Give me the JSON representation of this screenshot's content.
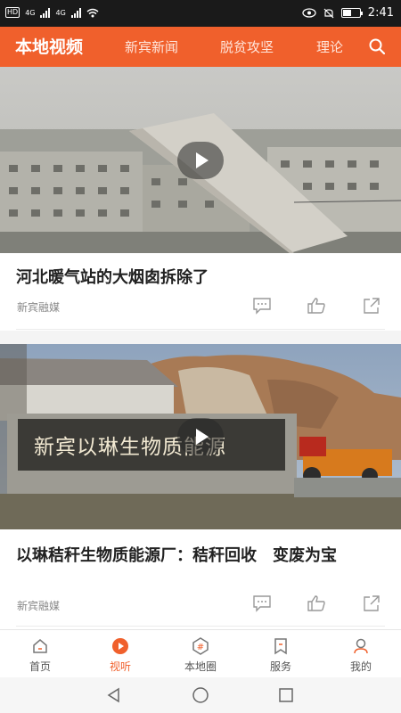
{
  "status_bar": {
    "hd_badge": "HD",
    "net1": "4G",
    "net2": "4G",
    "time": "2:41"
  },
  "header": {
    "tabs": [
      {
        "label": "本地视频",
        "active": true
      },
      {
        "label": "新宾新闻",
        "active": false
      },
      {
        "label": "脱贫攻坚",
        "active": false
      },
      {
        "label": "理论",
        "active": false
      }
    ],
    "accent_color": "#f0602c"
  },
  "feed": [
    {
      "title": "河北暖气站的大烟囱拆除了",
      "source": "新宾融媒"
    },
    {
      "title": "以琳秸秆生物质能源厂：秸秆回收　变废为宝",
      "source": "新宾融媒",
      "sign_text": "新宾以琳生物质能源"
    }
  ],
  "bottom_nav": [
    {
      "label": "首页",
      "icon": "home-icon"
    },
    {
      "label": "视听",
      "icon": "play-circle-icon",
      "active": true
    },
    {
      "label": "本地圈",
      "icon": "hashtag-icon"
    },
    {
      "label": "服务",
      "icon": "bookmark-icon"
    },
    {
      "label": "我的",
      "icon": "user-icon"
    }
  ]
}
